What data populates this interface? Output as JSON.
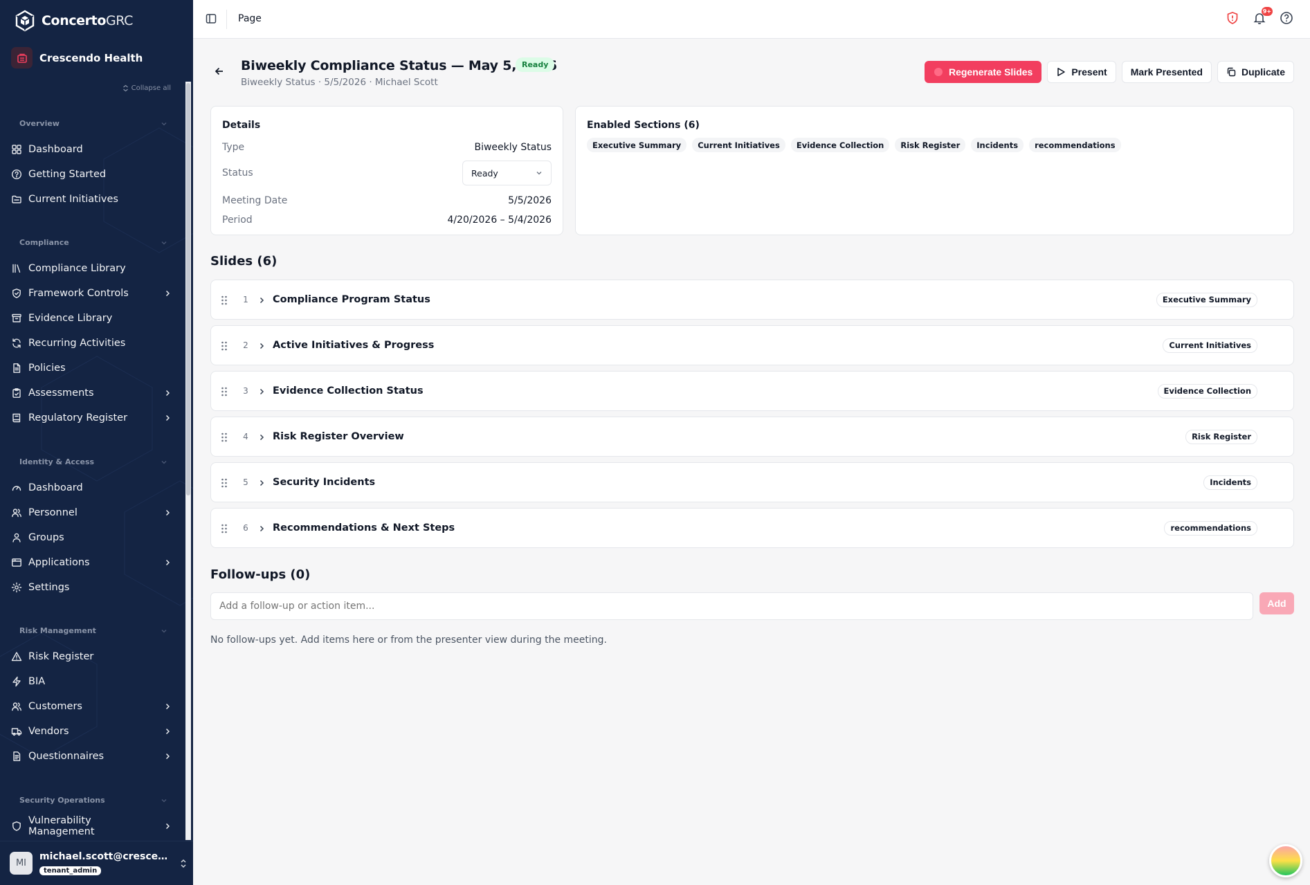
{
  "app": {
    "logo_bold": "Concerto",
    "logo_light": "GRC",
    "org_name": "Crescendo Health",
    "collapse_all": "Collapse all"
  },
  "sidebar": {
    "groups": [
      {
        "title": "Overview",
        "items": [
          {
            "label": "Dashboard",
            "icon": "dashboard-icon"
          },
          {
            "label": "Getting Started",
            "icon": "help-circle-icon"
          },
          {
            "label": "Current Initiatives",
            "icon": "folder-icon"
          }
        ]
      },
      {
        "title": "Compliance",
        "items": [
          {
            "label": "Compliance Library",
            "icon": "library-icon"
          },
          {
            "label": "Framework Controls",
            "icon": "shield-check-icon",
            "chevron": true
          },
          {
            "label": "Evidence Library",
            "icon": "archive-icon"
          },
          {
            "label": "Recurring Activities",
            "icon": "refresh-icon"
          },
          {
            "label": "Policies",
            "icon": "file-text-icon"
          },
          {
            "label": "Assessments",
            "icon": "clipboard-icon",
            "chevron": true
          },
          {
            "label": "Regulatory Register",
            "icon": "book-icon",
            "chevron": true
          }
        ]
      },
      {
        "title": "Identity & Access",
        "items": [
          {
            "label": "Dashboard",
            "icon": "gauge-icon"
          },
          {
            "label": "Personnel",
            "icon": "users-icon",
            "chevron": true
          },
          {
            "label": "Groups",
            "icon": "user-group-icon"
          },
          {
            "label": "Applications",
            "icon": "app-window-icon",
            "chevron": true
          },
          {
            "label": "Settings",
            "icon": "gear-icon"
          }
        ]
      },
      {
        "title": "Risk Management",
        "items": [
          {
            "label": "Risk Register",
            "icon": "alert-triangle-icon"
          },
          {
            "label": "BIA",
            "icon": "zap-icon"
          },
          {
            "label": "Customers",
            "icon": "users-icon",
            "chevron": true
          },
          {
            "label": "Vendors",
            "icon": "truck-icon",
            "chevron": true
          },
          {
            "label": "Questionnaires",
            "icon": "file-list-icon",
            "chevron": true
          }
        ]
      },
      {
        "title": "Security Operations",
        "items": [
          {
            "label": "Vulnerability Management",
            "icon": "shield-icon",
            "chevron": true
          }
        ]
      }
    ],
    "user": {
      "initials": "MI",
      "email": "michael.scott@crescendohealth.com",
      "role": "tenant_admin"
    }
  },
  "topbar": {
    "title": "Page",
    "notification_count": "9+"
  },
  "page": {
    "title": "Biweekly Compliance Status — May 5, 2026",
    "status_badge": "Ready",
    "subtitle": "Biweekly Status · 5/5/2026 · Michael Scott",
    "actions": {
      "regenerate": "Regenerate Slides",
      "present": "Present",
      "mark_presented": "Mark Presented",
      "duplicate": "Duplicate"
    }
  },
  "details": {
    "heading": "Details",
    "type_label": "Type",
    "type_value": "Biweekly Status",
    "status_label": "Status",
    "status_value": "Ready",
    "meeting_label": "Meeting Date",
    "meeting_value": "5/5/2026",
    "period_label": "Period",
    "period_value": "4/20/2026 – 5/4/2026"
  },
  "enabled_sections": {
    "heading": "Enabled Sections (6)",
    "chips": [
      "Executive Summary",
      "Current Initiatives",
      "Evidence Collection",
      "Risk Register",
      "Incidents",
      "recommendations"
    ]
  },
  "slides": {
    "heading": "Slides (6)",
    "items": [
      {
        "num": "1",
        "title": "Compliance Program Status",
        "tag": "Executive Summary"
      },
      {
        "num": "2",
        "title": "Active Initiatives & Progress",
        "tag": "Current Initiatives"
      },
      {
        "num": "3",
        "title": "Evidence Collection Status",
        "tag": "Evidence Collection"
      },
      {
        "num": "4",
        "title": "Risk Register Overview",
        "tag": "Risk Register"
      },
      {
        "num": "5",
        "title": "Security Incidents",
        "tag": "Incidents"
      },
      {
        "num": "6",
        "title": "Recommendations & Next Steps",
        "tag": "recommendations"
      }
    ]
  },
  "followups": {
    "heading": "Follow-ups (0)",
    "placeholder": "Add a follow-up or action item...",
    "add_label": "Add",
    "empty_text": "No follow-ups yet. Add items here or from the presenter view during the meeting."
  },
  "colors": {
    "sidebar_bg": "#142443",
    "accent": "#f23e5f",
    "ready_green": "#15803d"
  }
}
